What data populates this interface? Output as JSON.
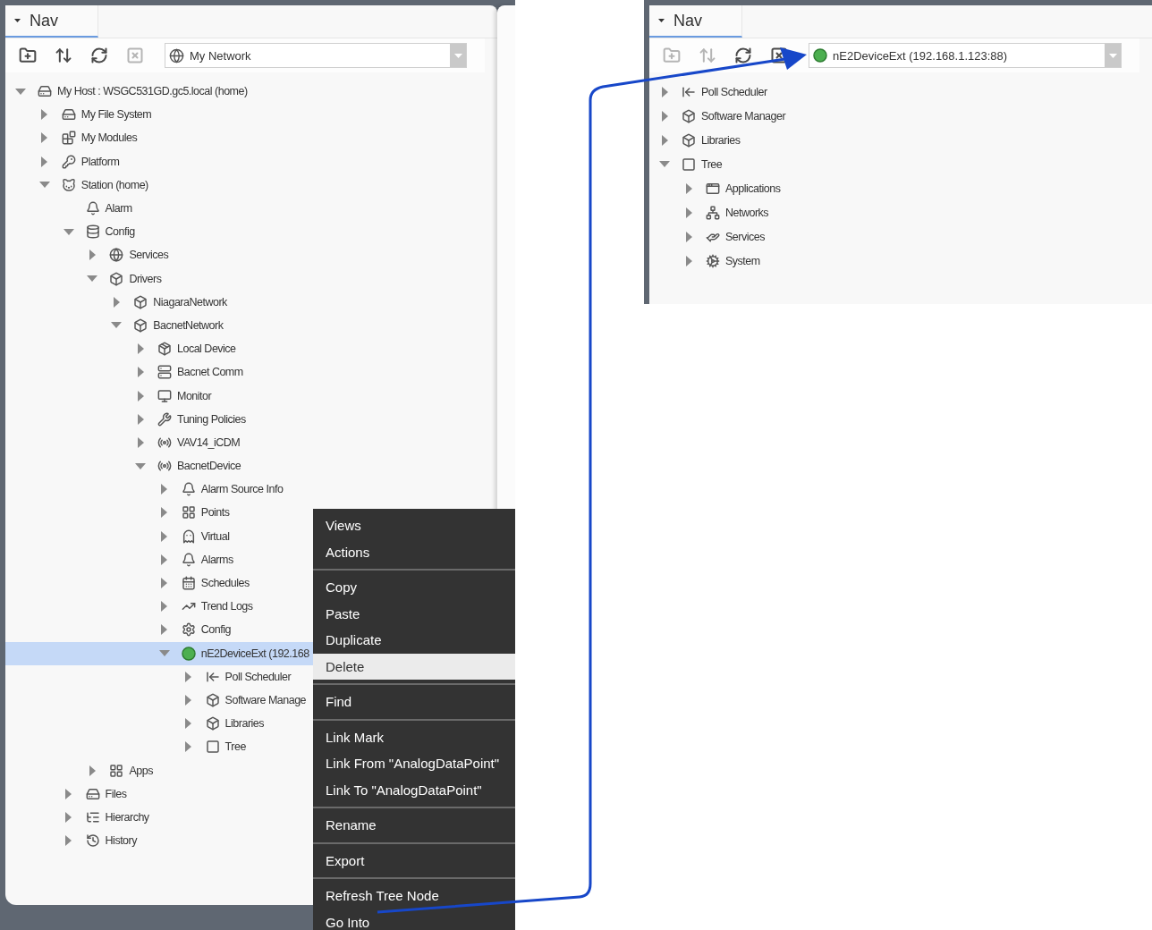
{
  "left_window": {
    "nav_tab": {
      "label": "Nav",
      "selected": true
    },
    "toolbar": [
      {
        "kind": "folder",
        "disabled": false
      },
      {
        "kind": "sort",
        "disabled": false
      },
      {
        "kind": "refresh",
        "disabled": false
      },
      {
        "kind": "close",
        "disabled": true
      }
    ],
    "location": {
      "kind": "network",
      "value": "My Network"
    },
    "tree": [
      {
        "label": "My Host : WSGC531GD.gc5.local (home)",
        "kind": "host",
        "expandable": true,
        "expanded": true,
        "selected": false,
        "children": [
          {
            "label": "My File System",
            "kind": "filesystem",
            "expandable": true,
            "expanded": false,
            "selected": false
          },
          {
            "label": "My Modules",
            "kind": "modules",
            "expandable": true,
            "expanded": false,
            "selected": false
          },
          {
            "label": "Platform",
            "kind": "platform",
            "expandable": true,
            "expanded": false,
            "selected": false
          },
          {
            "label": "Station (home)",
            "kind": "station",
            "expandable": true,
            "expanded": true,
            "selected": false,
            "children": [
              {
                "label": "Alarm",
                "kind": "alarm",
                "expandable": false,
                "expanded": false,
                "selected": false
              },
              {
                "label": "Config",
                "kind": "config",
                "expandable": true,
                "expanded": true,
                "selected": false,
                "children": [
                  {
                    "label": "Services",
                    "kind": "services",
                    "expandable": true,
                    "expanded": false,
                    "selected": false
                  },
                  {
                    "label": "Drivers",
                    "kind": "drivers",
                    "expandable": true,
                    "expanded": true,
                    "selected": false,
                    "children": [
                      {
                        "label": "NiagaraNetwork",
                        "kind": "drivers",
                        "expandable": true,
                        "expanded": false,
                        "selected": false
                      },
                      {
                        "label": "BacnetNetwork",
                        "kind": "drivers",
                        "expandable": true,
                        "expanded": true,
                        "selected": false,
                        "children": [
                          {
                            "label": "Local Device",
                            "kind": "localdevice",
                            "expandable": true,
                            "expanded": false,
                            "selected": false
                          },
                          {
                            "label": "Bacnet Comm",
                            "kind": "comm",
                            "expandable": true,
                            "expanded": false,
                            "selected": false
                          },
                          {
                            "label": "Monitor",
                            "kind": "monitor",
                            "expandable": true,
                            "expanded": false,
                            "selected": false
                          },
                          {
                            "label": "Tuning Policies",
                            "kind": "tuning",
                            "expandable": true,
                            "expanded": false,
                            "selected": false
                          },
                          {
                            "label": "VAV14_iCDM",
                            "kind": "device",
                            "expandable": true,
                            "expanded": false,
                            "selected": false
                          },
                          {
                            "label": "BacnetDevice",
                            "kind": "device",
                            "expandable": true,
                            "expanded": true,
                            "selected": false,
                            "children": [
                              {
                                "label": "Alarm Source Info",
                                "kind": "alarmsource",
                                "expandable": true,
                                "expanded": false,
                                "selected": false
                              },
                              {
                                "label": "Points",
                                "kind": "points",
                                "expandable": true,
                                "expanded": false,
                                "selected": false
                              },
                              {
                                "label": "Virtual",
                                "kind": "virtual",
                                "expandable": true,
                                "expanded": false,
                                "selected": false
                              },
                              {
                                "label": "Alarms",
                                "kind": "alarmsource",
                                "expandable": true,
                                "expanded": false,
                                "selected": false
                              },
                              {
                                "label": "Schedules",
                                "kind": "schedules",
                                "expandable": true,
                                "expanded": false,
                                "selected": false
                              },
                              {
                                "label": "Trend Logs",
                                "kind": "trend",
                                "expandable": true,
                                "expanded": false,
                                "selected": false
                              },
                              {
                                "label": "Config",
                                "kind": "config2",
                                "expandable": true,
                                "expanded": false,
                                "selected": false
                              },
                              {
                                "label": "nE2DeviceExt (192.168",
                                "kind": "status",
                                "expandable": true,
                                "expanded": true,
                                "selected": true,
                                "children": [
                                  {
                                    "label": "Poll Scheduler",
                                    "kind": "poll",
                                    "expandable": true,
                                    "expanded": false,
                                    "selected": false
                                  },
                                  {
                                    "label": "Software Manage",
                                    "kind": "software",
                                    "expandable": true,
                                    "expanded": false,
                                    "selected": false
                                  },
                                  {
                                    "label": "Libraries",
                                    "kind": "software",
                                    "expandable": true,
                                    "expanded": false,
                                    "selected": false
                                  },
                                  {
                                    "label": "Tree",
                                    "kind": "tree",
                                    "expandable": true,
                                    "expanded": false,
                                    "selected": false
                                  }
                                ]
                              }
                            ]
                          }
                        ]
                      }
                    ]
                  },
                  {
                    "label": "Apps",
                    "kind": "apps",
                    "expandable": true,
                    "expanded": false,
                    "selected": false
                  }
                ]
              },
              {
                "label": "Files",
                "kind": "filesystem",
                "expandable": true,
                "expanded": false,
                "selected": false
              },
              {
                "label": "Hierarchy",
                "kind": "hierarchy",
                "expandable": true,
                "expanded": false,
                "selected": false
              },
              {
                "label": "History",
                "kind": "history",
                "expandable": true,
                "expanded": false,
                "selected": false
              }
            ]
          }
        ]
      }
    ],
    "context_menu": {
      "groups": [
        [
          {
            "label": "Views",
            "selected": false
          },
          {
            "label": "Actions",
            "selected": false
          }
        ],
        [
          {
            "label": "Copy",
            "selected": false
          },
          {
            "label": "Paste",
            "selected": false
          },
          {
            "label": "Duplicate",
            "selected": false
          },
          {
            "label": "Delete",
            "selected": true
          }
        ],
        [
          {
            "label": "Find",
            "selected": false
          }
        ],
        [
          {
            "label": "Link Mark",
            "selected": false
          },
          {
            "label": "Link From \"AnalogDataPoint\"",
            "selected": false
          },
          {
            "label": "Link To \"AnalogDataPoint\"",
            "selected": false
          }
        ],
        [
          {
            "label": "Rename",
            "selected": false
          }
        ],
        [
          {
            "label": "Export",
            "selected": false
          }
        ],
        [
          {
            "label": "Refresh Tree Node",
            "selected": false
          },
          {
            "label": "Go Into",
            "selected": false
          }
        ]
      ]
    }
  },
  "right_window": {
    "nav_tab": {
      "label": "Nav",
      "selected": true
    },
    "toolbar": [
      {
        "kind": "folder",
        "disabled": true
      },
      {
        "kind": "sort",
        "disabled": true
      },
      {
        "kind": "refresh",
        "disabled": false
      },
      {
        "kind": "close",
        "disabled": false
      }
    ],
    "location": {
      "kind": "status",
      "value": "nE2DeviceExt (192.168.1.123:88)"
    },
    "tree": [
      {
        "label": "Poll Scheduler",
        "kind": "poll",
        "expandable": true,
        "expanded": false,
        "selected": false
      },
      {
        "label": "Software Manager",
        "kind": "software",
        "expandable": true,
        "expanded": false,
        "selected": false
      },
      {
        "label": "Libraries",
        "kind": "software",
        "expandable": true,
        "expanded": false,
        "selected": false
      },
      {
        "label": "Tree",
        "kind": "tree",
        "expandable": true,
        "expanded": true,
        "selected": false,
        "children": [
          {
            "label": "Applications",
            "kind": "applications",
            "expandable": true,
            "expanded": false,
            "selected": false
          },
          {
            "label": "Networks",
            "kind": "networks",
            "expandable": true,
            "expanded": false,
            "selected": false
          },
          {
            "label": "Services",
            "kind": "handservices",
            "expandable": true,
            "expanded": false,
            "selected": false
          },
          {
            "label": "System",
            "kind": "system",
            "expandable": true,
            "expanded": false,
            "selected": false
          }
        ]
      }
    ]
  }
}
